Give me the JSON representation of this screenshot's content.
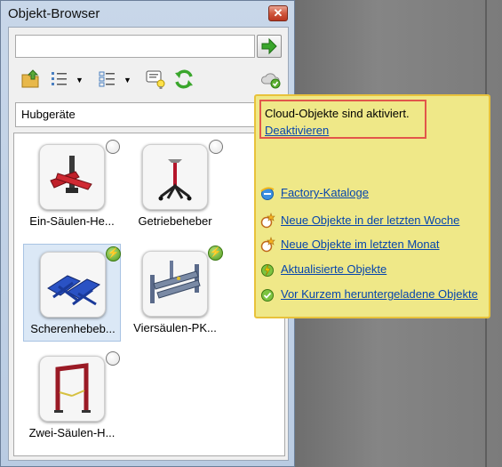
{
  "window": {
    "title": "Objekt-Browser",
    "close_symbol": "✕"
  },
  "search": {
    "value": ""
  },
  "toolbar": {
    "dropdown_arrow": "▼"
  },
  "category": {
    "selected": "Hubgeräte"
  },
  "items": [
    {
      "label": "Ein-Säulen-He...",
      "status": "not-downloaded",
      "selected": false
    },
    {
      "label": "Getriebeheber",
      "status": "not-downloaded",
      "selected": false
    },
    {
      "label": "Scherenhebeb...",
      "status": "updated",
      "selected": true
    },
    {
      "label": "Viersäulen-PK...",
      "status": "updated",
      "selected": false
    },
    {
      "label": "Zwei-Säulen-H...",
      "status": "not-downloaded",
      "selected": false
    }
  ],
  "popup": {
    "notice": "Cloud-Objekte sind aktiviert.",
    "deactivate": "Deaktivieren",
    "links": [
      {
        "icon": "ie-globe-icon",
        "label": "Factory-Kataloge"
      },
      {
        "icon": "new-star-icon",
        "label": "Neue Objekte in der letzten Woche"
      },
      {
        "icon": "new-star-icon",
        "label": "Neue Objekte im letzten Monat"
      },
      {
        "icon": "update-icon",
        "label": "Aktualisierte Objekte"
      },
      {
        "icon": "downloaded-check-icon",
        "label": "Vor Kurzem heruntergeladene Objekte"
      }
    ]
  },
  "colors": {
    "link": "#0645ad",
    "popup_bg": "#efe888",
    "popup_border": "#e8c23b",
    "highlight_border": "#e2564a",
    "selection": "#dbe8f6"
  }
}
